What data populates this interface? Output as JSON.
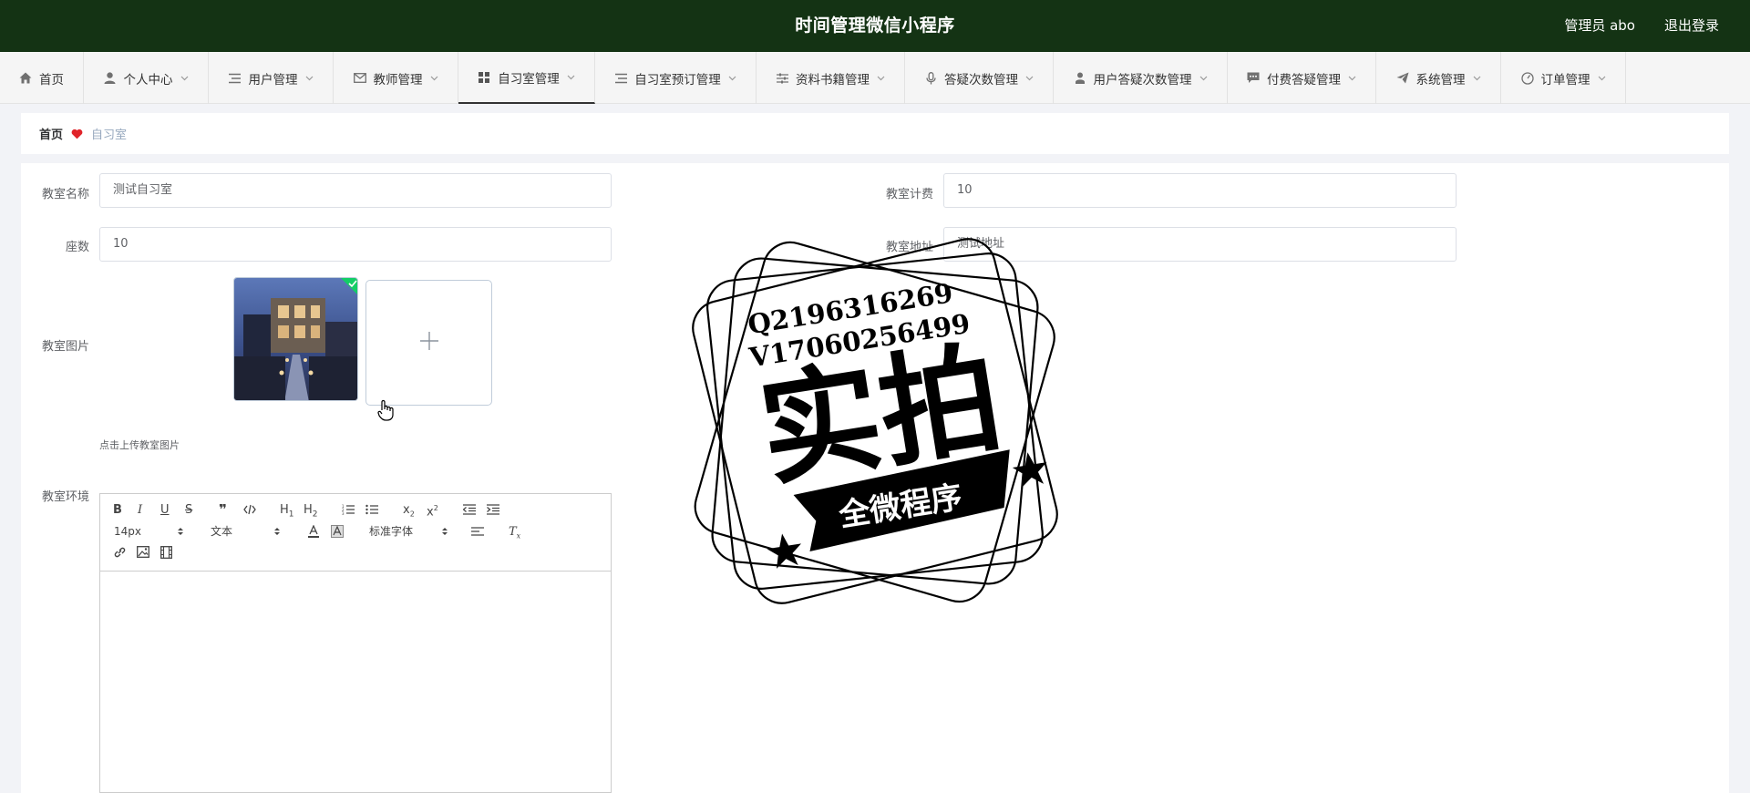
{
  "header": {
    "title": "时间管理微信小程序",
    "user": "管理员 abo",
    "logout": "退出登录"
  },
  "nav": [
    {
      "label": "首页",
      "icon": "home-icon",
      "w": 92,
      "chevron": false
    },
    {
      "label": "个人中心",
      "icon": "user-icon",
      "w": 137,
      "chevron": true
    },
    {
      "label": "用户管理",
      "icon": "list-icon",
      "w": 137,
      "chevron": true
    },
    {
      "label": "教师管理",
      "icon": "mail-icon",
      "w": 137,
      "chevron": true
    },
    {
      "label": "自习室管理",
      "icon": "grid-icon",
      "w": 150,
      "chevron": true,
      "active": true
    },
    {
      "label": "自习室预订管理",
      "icon": "list-icon",
      "w": 177,
      "chevron": true
    },
    {
      "label": "资料书籍管理",
      "icon": "sliders-icon",
      "w": 163,
      "chevron": true
    },
    {
      "label": "答疑次数管理",
      "icon": "mic-icon",
      "w": 163,
      "chevron": true
    },
    {
      "label": "用户答疑次数管理",
      "icon": "person-icon",
      "w": 191,
      "chevron": true
    },
    {
      "label": "付费答疑管理",
      "icon": "chat-icon",
      "w": 163,
      "chevron": true
    },
    {
      "label": "系统管理",
      "icon": "send-icon",
      "w": 137,
      "chevron": true
    },
    {
      "label": "订单管理",
      "icon": "gauge-icon",
      "w": 137,
      "chevron": true
    }
  ],
  "breadcrumb": {
    "home": "首页",
    "current": "自习室"
  },
  "form": {
    "room_name_label": "教室名称",
    "room_name_value": "测试自习室",
    "fee_label": "教室计费",
    "fee_value": "10",
    "seats_label": "座数",
    "seats_value": "10",
    "address_label": "教室地址",
    "address_value": "测试地址",
    "image_label": "教室图片",
    "upload_tip": "点击上传教室图片",
    "env_label": "教室环境"
  },
  "editor": {
    "font_size": "14px",
    "header_select": "文本",
    "font_family": "标准字体"
  },
  "watermark": {
    "line1": "Q2196316269",
    "line2": "V17060256499",
    "big": "实拍",
    "ribbon": "全微程序"
  },
  "colors": {
    "header_bg": "#143314",
    "success": "#13ce66",
    "heart": "#e0242a"
  }
}
